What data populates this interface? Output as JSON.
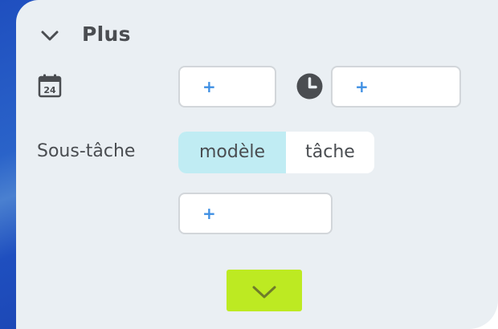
{
  "section": {
    "title": "Plus"
  },
  "date_row": {
    "calendar_day": "24",
    "date_add": "+",
    "time_add": "+"
  },
  "subtask": {
    "label": "Sous-tâche",
    "options": [
      "modèle",
      "tâche"
    ],
    "selected": "modèle",
    "add": "+"
  },
  "icons": {
    "collapse": "chevron-down-icon",
    "calendar": "calendar-icon",
    "clock": "clock-icon",
    "confirm": "checkmark-icon"
  },
  "colors": {
    "panel": "#eaeff3",
    "accent_plus": "#3f8fe3",
    "selected_segment": "#c0ecf3",
    "confirm_button": "#bdea22",
    "side_gradient": "#1f4fbf"
  }
}
